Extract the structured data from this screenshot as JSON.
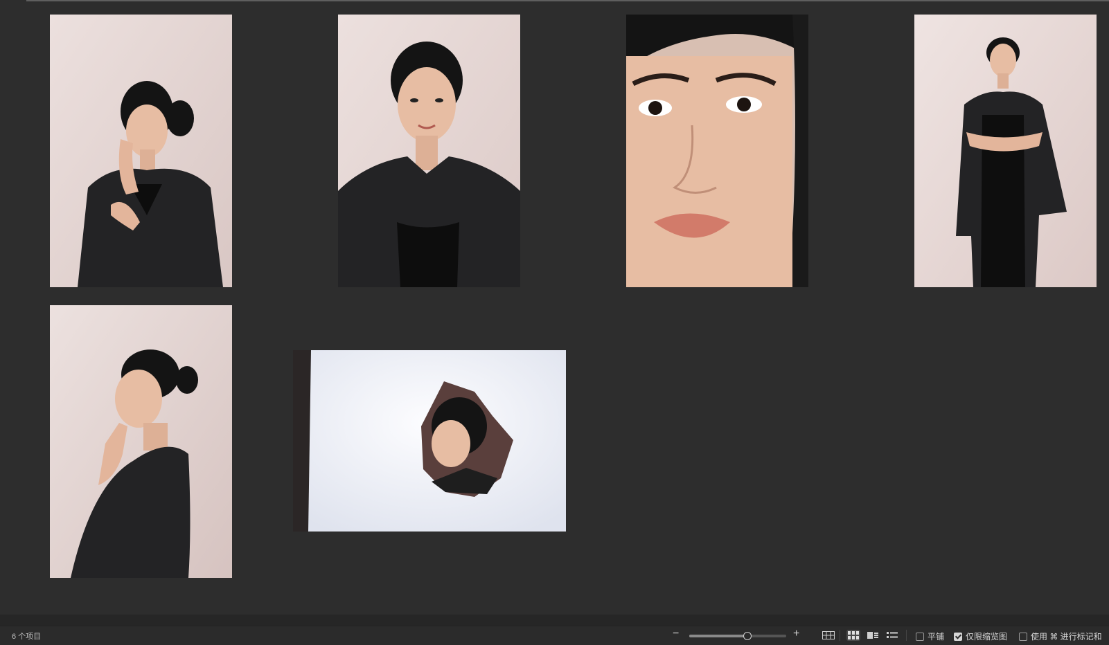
{
  "status": {
    "item_count": "6 个项目",
    "zoom_level": 0.6,
    "options": {
      "tile": {
        "label": "平铺",
        "checked": false
      },
      "thumbnails_only": {
        "label": "仅限缩览图",
        "checked": true
      },
      "use_tag": {
        "label": "使用 ⌘ 进行标记和",
        "checked": false
      }
    },
    "view_modes": [
      "grid-large",
      "grid-small",
      "grid-detail",
      "list"
    ],
    "active_view": "grid-small"
  },
  "photos": [
    {
      "pose": "hand-on-cheek"
    },
    {
      "pose": "front-portrait"
    },
    {
      "pose": "face-closeup"
    },
    {
      "pose": "full-body-arms-crossed"
    },
    {
      "pose": "profile-hand-on-chin"
    },
    {
      "pose": "torn-paper-portrait"
    }
  ],
  "colors": {
    "background": "#2d2d2d",
    "backdrop": "#e6d6d6",
    "skin": "#e7bda3",
    "hair": "#121212",
    "suit": "#232325"
  }
}
